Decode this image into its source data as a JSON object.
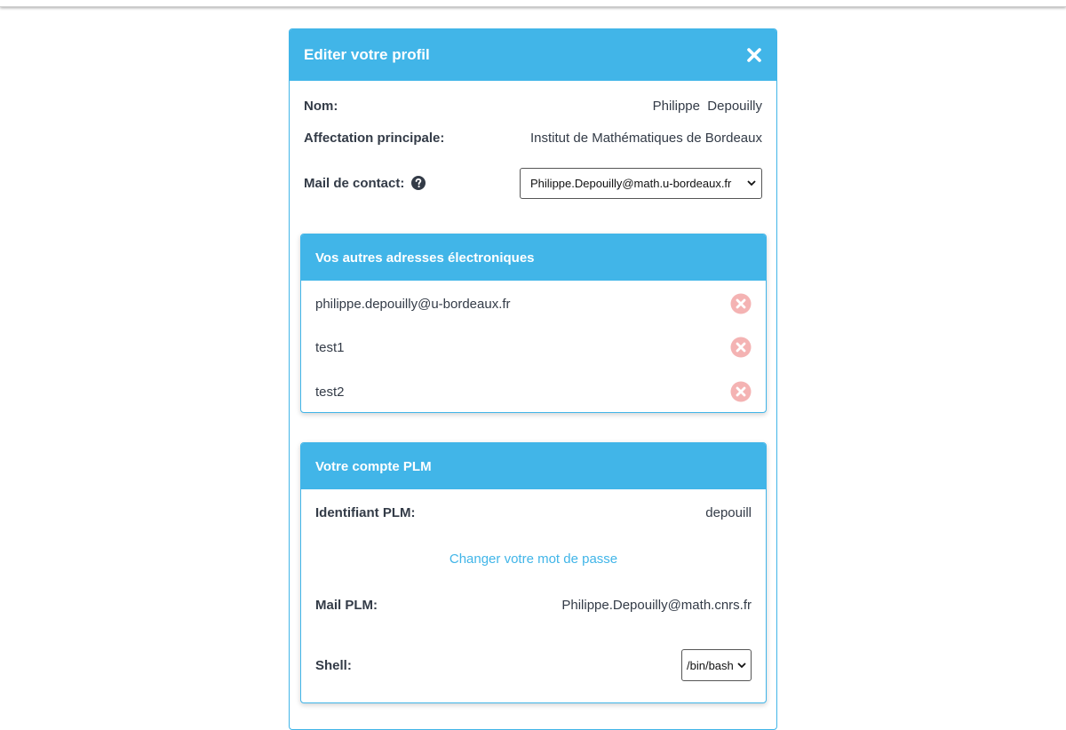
{
  "modal": {
    "title": "Editer votre profil"
  },
  "profile": {
    "name_label": "Nom:",
    "name_value": "Philippe  Depouilly",
    "affiliation_label": "Affectation principale:",
    "affiliation_value": "Institut de Mathématiques de Bordeaux",
    "contact_mail_label": "Mail de contact:",
    "contact_mail_selected": "Philippe.Depouilly@math.u-bordeaux.fr"
  },
  "other_addresses": {
    "title": "Vos autres adresses électroniques",
    "items": [
      {
        "email": "philippe.depouilly@u-bordeaux.fr"
      },
      {
        "email": "test1"
      },
      {
        "email": "test2"
      }
    ]
  },
  "plm_account": {
    "title": "Votre compte PLM",
    "id_label": "Identifiant PLM:",
    "id_value": "depouill",
    "change_password_link": "Changer votre mot de passe",
    "mail_label": "Mail PLM:",
    "mail_value": "Philippe.Depouilly@math.cnrs.fr",
    "shell_label": "Shell:",
    "shell_selected": "/bin/bash"
  },
  "colors": {
    "accent": "#41b5e8",
    "remove_icon": "#f4b3b3"
  },
  "icons": {
    "close": "close-icon",
    "help": "question-circle-icon",
    "remove": "remove-circle-icon",
    "dropdown": "chevron-down-icon"
  }
}
